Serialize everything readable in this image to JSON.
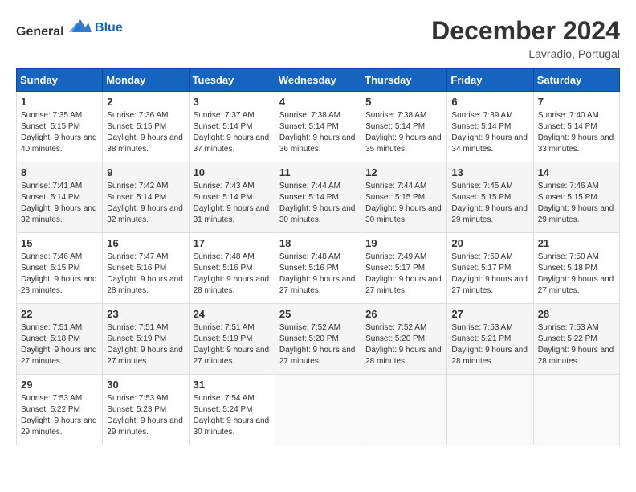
{
  "header": {
    "logo": {
      "general": "General",
      "blue": "Blue"
    },
    "title": "December 2024",
    "location": "Lavradio, Portugal"
  },
  "calendar": {
    "headers": [
      "Sunday",
      "Monday",
      "Tuesday",
      "Wednesday",
      "Thursday",
      "Friday",
      "Saturday"
    ],
    "weeks": [
      [
        {
          "day": "1",
          "sunrise": "7:35 AM",
          "sunset": "5:15 PM",
          "daylight": "9 hours and 40 minutes."
        },
        {
          "day": "2",
          "sunrise": "7:36 AM",
          "sunset": "5:15 PM",
          "daylight": "9 hours and 38 minutes."
        },
        {
          "day": "3",
          "sunrise": "7:37 AM",
          "sunset": "5:14 PM",
          "daylight": "9 hours and 37 minutes."
        },
        {
          "day": "4",
          "sunrise": "7:38 AM",
          "sunset": "5:14 PM",
          "daylight": "9 hours and 36 minutes."
        },
        {
          "day": "5",
          "sunrise": "7:38 AM",
          "sunset": "5:14 PM",
          "daylight": "9 hours and 35 minutes."
        },
        {
          "day": "6",
          "sunrise": "7:39 AM",
          "sunset": "5:14 PM",
          "daylight": "9 hours and 34 minutes."
        },
        {
          "day": "7",
          "sunrise": "7:40 AM",
          "sunset": "5:14 PM",
          "daylight": "9 hours and 33 minutes."
        }
      ],
      [
        {
          "day": "8",
          "sunrise": "7:41 AM",
          "sunset": "5:14 PM",
          "daylight": "9 hours and 32 minutes."
        },
        {
          "day": "9",
          "sunrise": "7:42 AM",
          "sunset": "5:14 PM",
          "daylight": "9 hours and 32 minutes."
        },
        {
          "day": "10",
          "sunrise": "7:43 AM",
          "sunset": "5:14 PM",
          "daylight": "9 hours and 31 minutes."
        },
        {
          "day": "11",
          "sunrise": "7:44 AM",
          "sunset": "5:14 PM",
          "daylight": "9 hours and 30 minutes."
        },
        {
          "day": "12",
          "sunrise": "7:44 AM",
          "sunset": "5:15 PM",
          "daylight": "9 hours and 30 minutes."
        },
        {
          "day": "13",
          "sunrise": "7:45 AM",
          "sunset": "5:15 PM",
          "daylight": "9 hours and 29 minutes."
        },
        {
          "day": "14",
          "sunrise": "7:46 AM",
          "sunset": "5:15 PM",
          "daylight": "9 hours and 29 minutes."
        }
      ],
      [
        {
          "day": "15",
          "sunrise": "7:46 AM",
          "sunset": "5:15 PM",
          "daylight": "9 hours and 28 minutes."
        },
        {
          "day": "16",
          "sunrise": "7:47 AM",
          "sunset": "5:16 PM",
          "daylight": "9 hours and 28 minutes."
        },
        {
          "day": "17",
          "sunrise": "7:48 AM",
          "sunset": "5:16 PM",
          "daylight": "9 hours and 28 minutes."
        },
        {
          "day": "18",
          "sunrise": "7:48 AM",
          "sunset": "5:16 PM",
          "daylight": "9 hours and 27 minutes."
        },
        {
          "day": "19",
          "sunrise": "7:49 AM",
          "sunset": "5:17 PM",
          "daylight": "9 hours and 27 minutes."
        },
        {
          "day": "20",
          "sunrise": "7:50 AM",
          "sunset": "5:17 PM",
          "daylight": "9 hours and 27 minutes."
        },
        {
          "day": "21",
          "sunrise": "7:50 AM",
          "sunset": "5:18 PM",
          "daylight": "9 hours and 27 minutes."
        }
      ],
      [
        {
          "day": "22",
          "sunrise": "7:51 AM",
          "sunset": "5:18 PM",
          "daylight": "9 hours and 27 minutes."
        },
        {
          "day": "23",
          "sunrise": "7:51 AM",
          "sunset": "5:19 PM",
          "daylight": "9 hours and 27 minutes."
        },
        {
          "day": "24",
          "sunrise": "7:51 AM",
          "sunset": "5:19 PM",
          "daylight": "9 hours and 27 minutes."
        },
        {
          "day": "25",
          "sunrise": "7:52 AM",
          "sunset": "5:20 PM",
          "daylight": "9 hours and 27 minutes."
        },
        {
          "day": "26",
          "sunrise": "7:52 AM",
          "sunset": "5:20 PM",
          "daylight": "9 hours and 28 minutes."
        },
        {
          "day": "27",
          "sunrise": "7:53 AM",
          "sunset": "5:21 PM",
          "daylight": "9 hours and 28 minutes."
        },
        {
          "day": "28",
          "sunrise": "7:53 AM",
          "sunset": "5:22 PM",
          "daylight": "9 hours and 28 minutes."
        }
      ],
      [
        {
          "day": "29",
          "sunrise": "7:53 AM",
          "sunset": "5:22 PM",
          "daylight": "9 hours and 29 minutes."
        },
        {
          "day": "30",
          "sunrise": "7:53 AM",
          "sunset": "5:23 PM",
          "daylight": "9 hours and 29 minutes."
        },
        {
          "day": "31",
          "sunrise": "7:54 AM",
          "sunset": "5:24 PM",
          "daylight": "9 hours and 30 minutes."
        },
        null,
        null,
        null,
        null
      ]
    ]
  }
}
